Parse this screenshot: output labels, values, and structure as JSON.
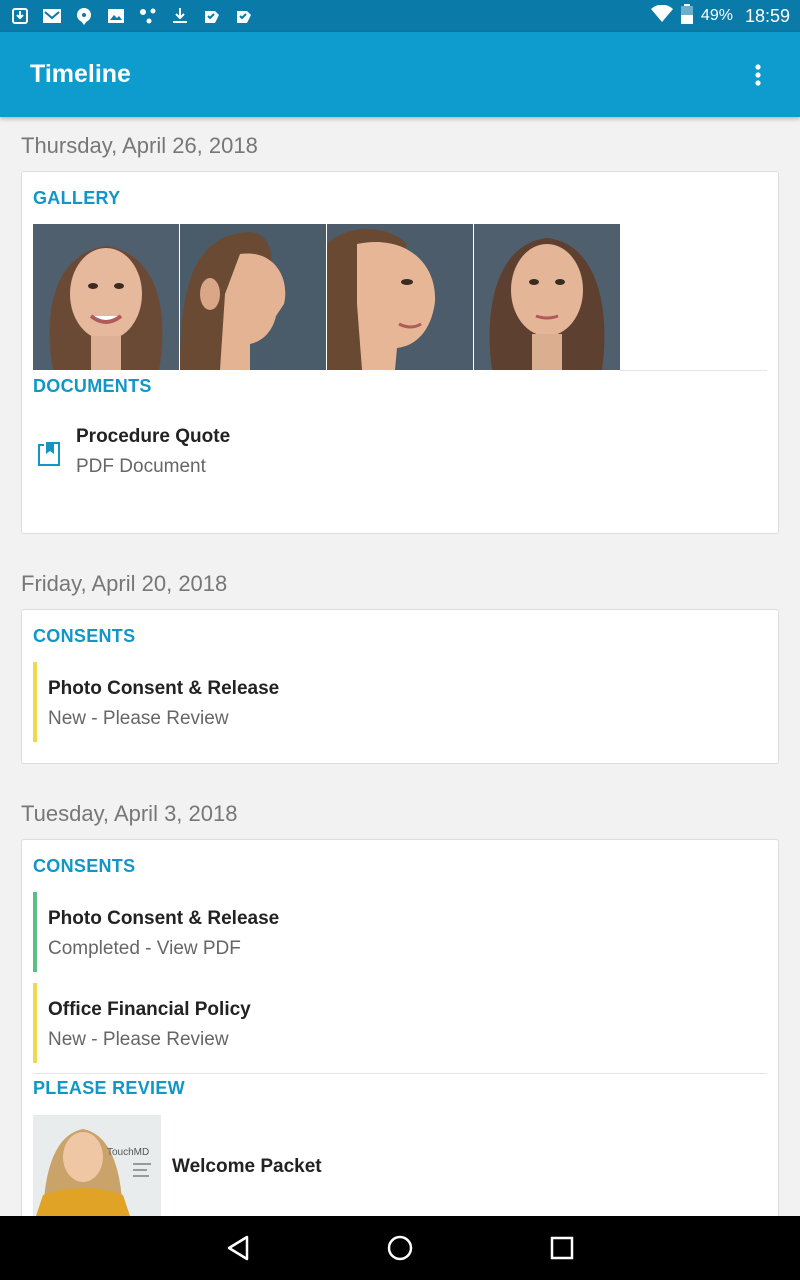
{
  "status_bar": {
    "battery": "49%",
    "time": "18:59",
    "notification_icons": [
      "download-icon",
      "mail-icon",
      "chat-icon",
      "image-icon",
      "share-icon",
      "download-icon",
      "check-icon",
      "check-icon"
    ]
  },
  "app_bar": {
    "title": "Timeline",
    "overflow_icon": "more-vert-icon"
  },
  "timeline": [
    {
      "date": "Thursday, April 26, 2018",
      "gallery": {
        "header": "GALLERY",
        "photos": [
          "front-smile",
          "profile-right",
          "three-quarter-right",
          "front-neutral"
        ]
      },
      "documents": {
        "header": "DOCUMENTS",
        "items": [
          {
            "title": "Procedure Quote",
            "subtitle": "PDF Document",
            "icon": "document-icon"
          }
        ]
      }
    },
    {
      "date": "Friday, April 20, 2018",
      "consents": {
        "header": "CONSENTS",
        "items": [
          {
            "title": "Photo Consent & Release",
            "subtitle": "New - Please Review",
            "status_color": "#f0d94a"
          }
        ]
      }
    },
    {
      "date": "Tuesday, April 3, 2018",
      "consents": {
        "header": "CONSENTS",
        "items": [
          {
            "title": "Photo Consent & Release",
            "subtitle": "Completed - View PDF",
            "status_color": "#5bbf86"
          },
          {
            "title": "Office Financial Policy",
            "subtitle": "New - Please Review",
            "status_color": "#f0d94a"
          }
        ]
      },
      "please_review": {
        "header": "PLEASE REVIEW",
        "items": [
          {
            "title": "Welcome Packet",
            "thumb_brand": "TouchMD"
          }
        ]
      }
    }
  ],
  "colors": {
    "status_bar": "#0a7aa8",
    "app_bar": "#0e9ccf",
    "accent": "#1196c8",
    "new_status": "#f0d94a",
    "completed_status": "#5bbf86"
  },
  "nav_bar": {
    "back_icon": "back-icon",
    "home_icon": "home-icon",
    "recents_icon": "recents-icon"
  }
}
